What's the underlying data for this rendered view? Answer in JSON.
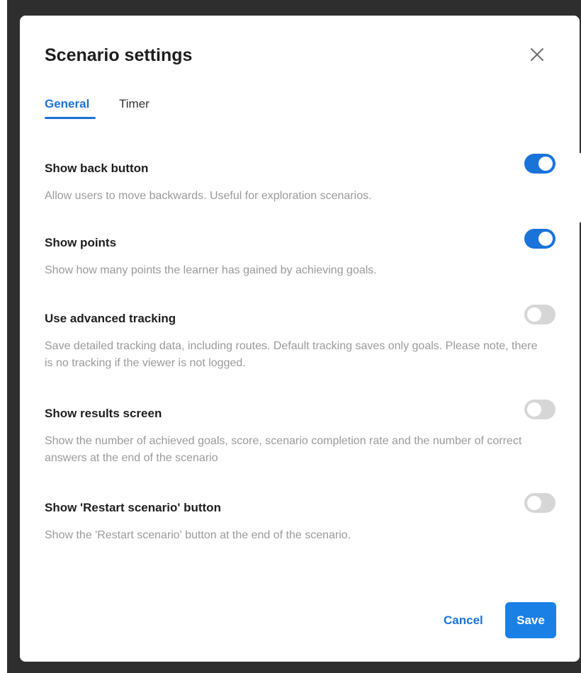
{
  "dialog": {
    "title": "Scenario settings",
    "close_icon": "close-icon"
  },
  "tabs": [
    {
      "label": "General",
      "active": true
    },
    {
      "label": "Timer",
      "active": false
    }
  ],
  "settings": [
    {
      "title": "Show back button",
      "description": "Allow users to move backwards. Useful for exploration scenarios.",
      "enabled": true
    },
    {
      "title": "Show points",
      "description": "Show how many points the learner has gained by achieving goals.",
      "enabled": true
    },
    {
      "title": "Use advanced tracking",
      "description": "Save detailed tracking data, including routes. Default tracking saves only goals. Please note, there is no tracking if the viewer is not logged.",
      "enabled": false
    },
    {
      "title": "Show results screen",
      "description": "Show the number of achieved goals, score, scenario completion rate and the number of correct answers at the end of the scenario",
      "enabled": false
    },
    {
      "title": "Show 'Restart scenario' button",
      "description": "Show the 'Restart scenario' button at the end of the scenario.",
      "enabled": false
    }
  ],
  "footer": {
    "cancel_label": "Cancel",
    "save_label": "Save"
  },
  "colors": {
    "accent": "#1a73d9",
    "save_button": "#1a80e6",
    "toggle_off": "#d6d6d6",
    "description_text": "#9a9a9a",
    "backdrop": "#2e2e2e"
  }
}
